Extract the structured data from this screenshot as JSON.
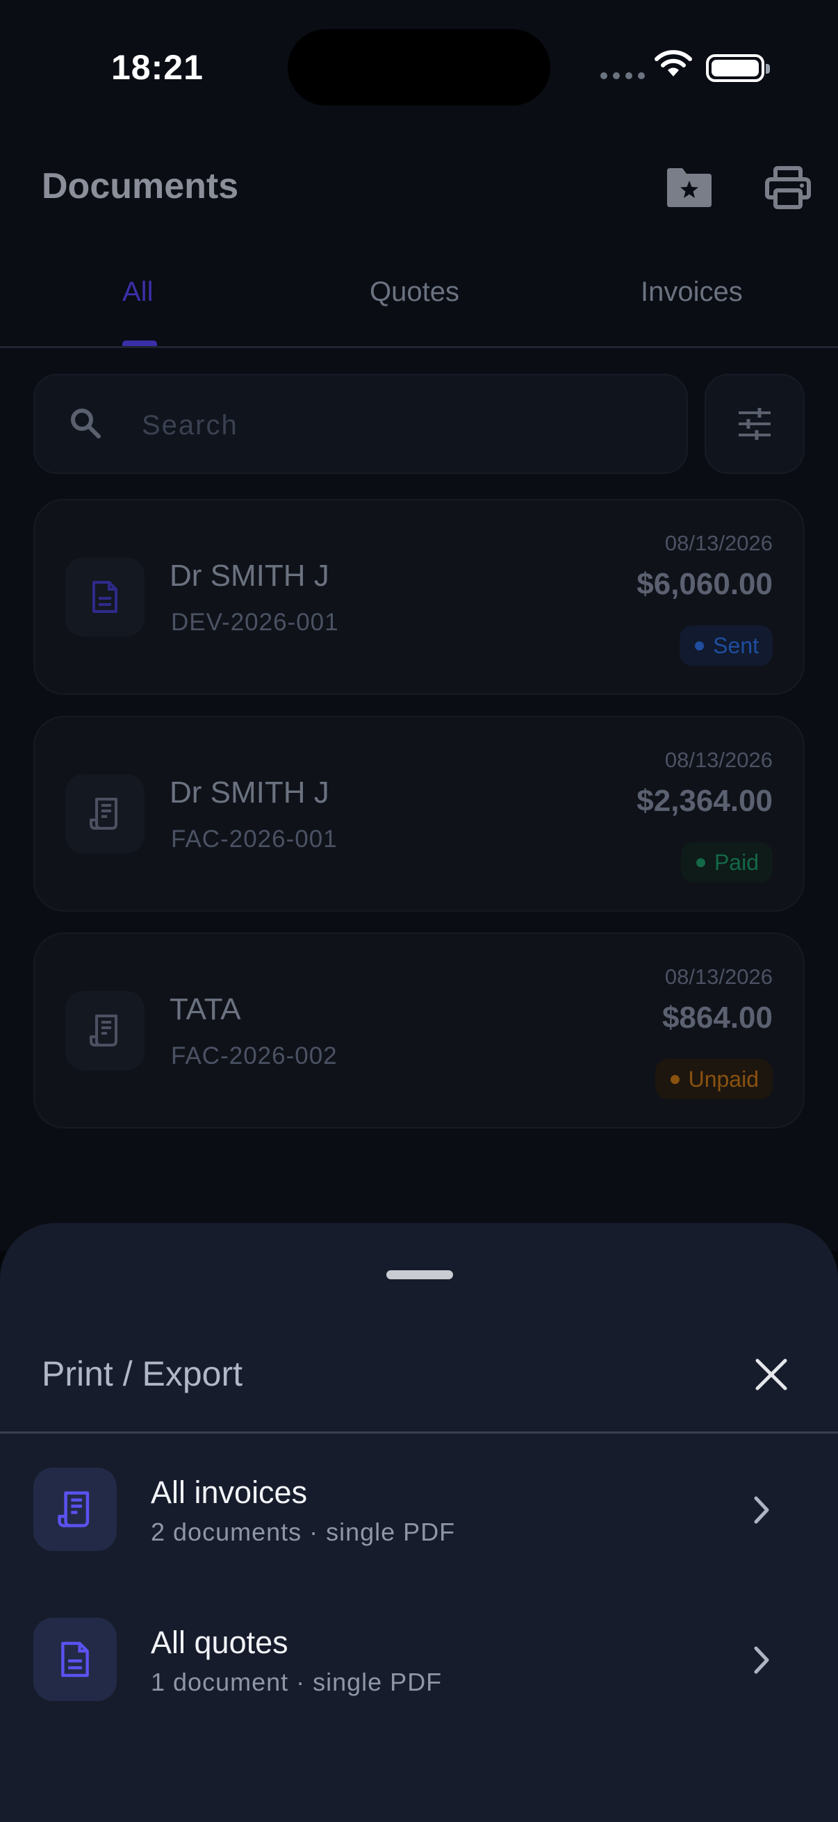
{
  "status": {
    "time": "18:21"
  },
  "header": {
    "title": "Documents"
  },
  "tabs": [
    {
      "label": "All",
      "active": true
    },
    {
      "label": "Quotes",
      "active": false
    },
    {
      "label": "Invoices",
      "active": false
    }
  ],
  "search": {
    "placeholder": "Search"
  },
  "documents": [
    {
      "title": "Dr SMITH J",
      "number": "DEV-2026-001",
      "date": "08/13/2026",
      "amount": "$6,060.00",
      "status": "Sent",
      "icon": "document-icon"
    },
    {
      "title": "Dr SMITH J",
      "number": "FAC-2026-001",
      "date": "08/13/2026",
      "amount": "$2,364.00",
      "status": "Paid",
      "icon": "receipt-icon"
    },
    {
      "title": "TATA",
      "number": "FAC-2026-002",
      "date": "08/13/2026",
      "amount": "$864.00",
      "status": "Unpaid",
      "icon": "receipt-icon"
    }
  ],
  "sheet": {
    "title": "Print / Export",
    "options": [
      {
        "title": "All invoices",
        "subtitle": "2 documents · single PDF",
        "icon": "receipt-icon"
      },
      {
        "title": "All quotes",
        "subtitle": "1 document · single PDF",
        "icon": "document-icon"
      }
    ]
  },
  "colors": {
    "accent": "#4f46e5",
    "sent": "#1f4ea0",
    "paid": "#136847",
    "unpaid": "#8a520f"
  }
}
